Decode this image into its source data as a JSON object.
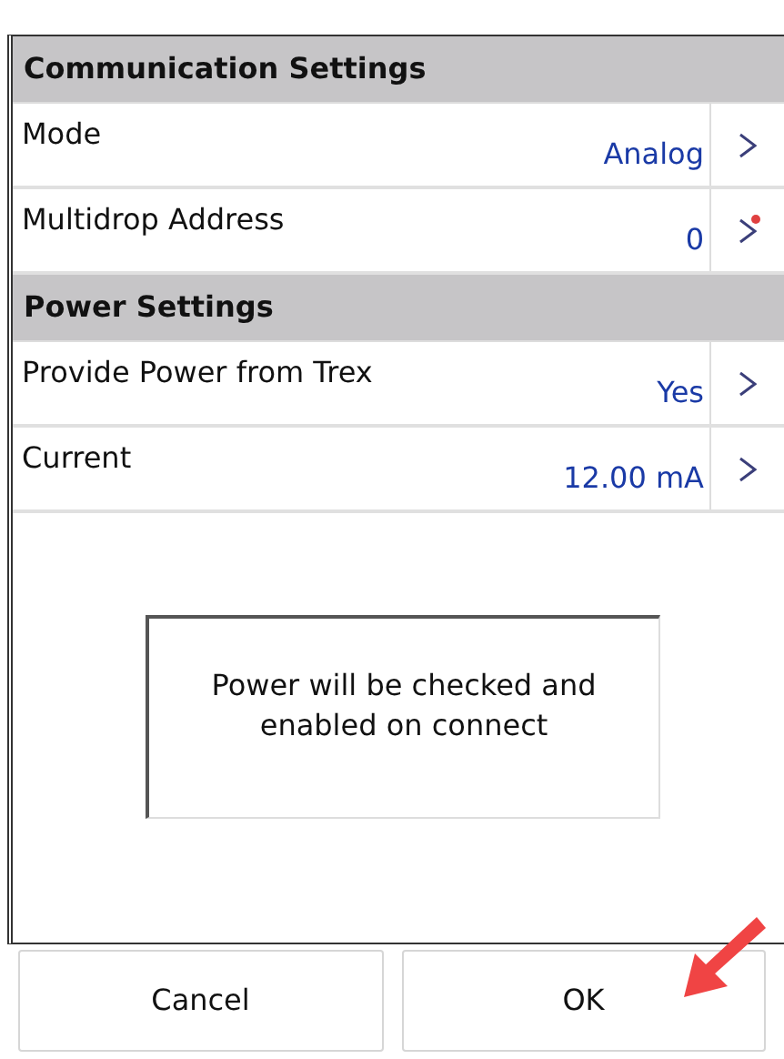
{
  "sections": [
    {
      "title": "Communication Settings",
      "rows": [
        {
          "label": "Mode",
          "value": "Analog",
          "changed": false
        },
        {
          "label": "Multidrop Address",
          "value": "0",
          "changed": true
        }
      ]
    },
    {
      "title": "Power Settings",
      "rows": [
        {
          "label": "Provide Power from Trex",
          "value": "Yes",
          "changed": false
        },
        {
          "label": "Current",
          "value": "12.00 mA",
          "changed": false
        }
      ]
    }
  ],
  "message": "Power will be checked and enabled on connect",
  "buttons": [
    {
      "label": "Cancel"
    },
    {
      "label": "OK"
    }
  ],
  "annotation": {
    "kind": "arrow"
  }
}
